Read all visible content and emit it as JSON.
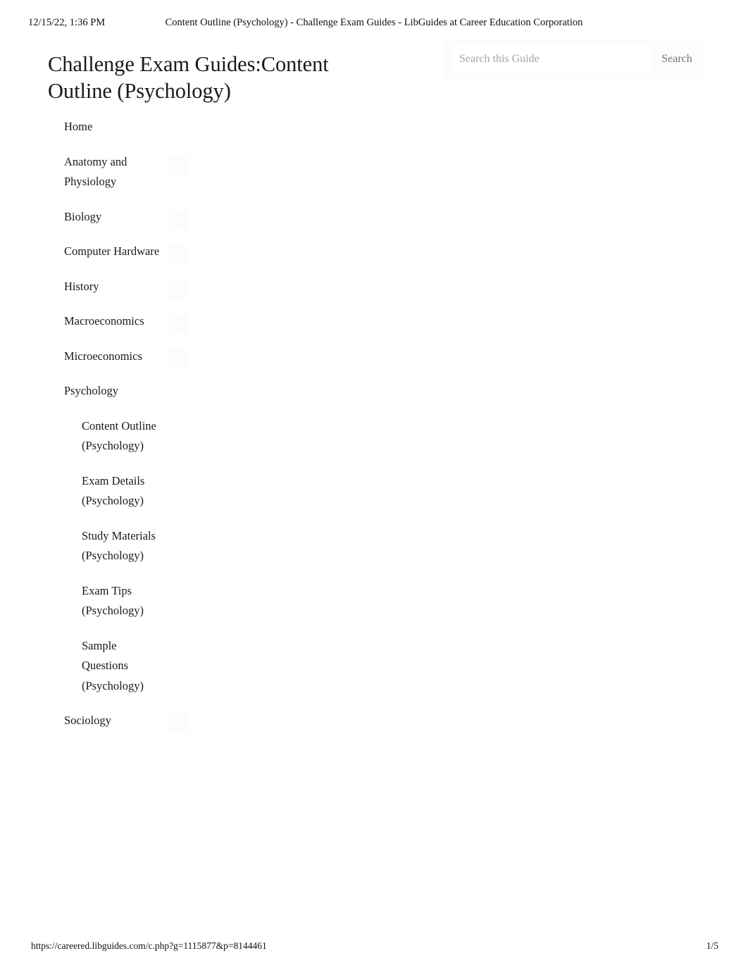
{
  "print_header": {
    "date": "12/15/22, 1:36 PM",
    "document_title": "Content Outline (Psychology) - Challenge Exam Guides - LibGuides at Career Education Corporation"
  },
  "guide": {
    "title": "Challenge Exam Guides:Content Outline (Psychology)"
  },
  "search": {
    "placeholder": "Search this Guide",
    "value": "",
    "button_label": "Search"
  },
  "nav": {
    "items": [
      {
        "label": "Home",
        "has_toggle": false,
        "children": []
      },
      {
        "label": "Anatomy and Physiology",
        "has_toggle": true,
        "children": []
      },
      {
        "label": "Biology",
        "has_toggle": true,
        "children": []
      },
      {
        "label": "Computer Hardware",
        "has_toggle": true,
        "children": []
      },
      {
        "label": "History",
        "has_toggle": true,
        "children": []
      },
      {
        "label": "Macroeconomics",
        "has_toggle": true,
        "children": []
      },
      {
        "label": "Microeconomics",
        "has_toggle": true,
        "children": []
      },
      {
        "label": "Psychology",
        "has_toggle": false,
        "children": [
          {
            "label": "Content Outline (Psychology)"
          },
          {
            "label": "Exam Details (Psychology)"
          },
          {
            "label": "Study Materials (Psychology)"
          },
          {
            "label": "Exam Tips (Psychology)"
          },
          {
            "label": "Sample Questions (Psychology)"
          }
        ]
      },
      {
        "label": "Sociology",
        "has_toggle": true,
        "children": []
      }
    ]
  },
  "print_footer": {
    "url": "https://careered.libguides.com/c.php?g=1115877&p=8144461",
    "page_number": "1/5"
  }
}
